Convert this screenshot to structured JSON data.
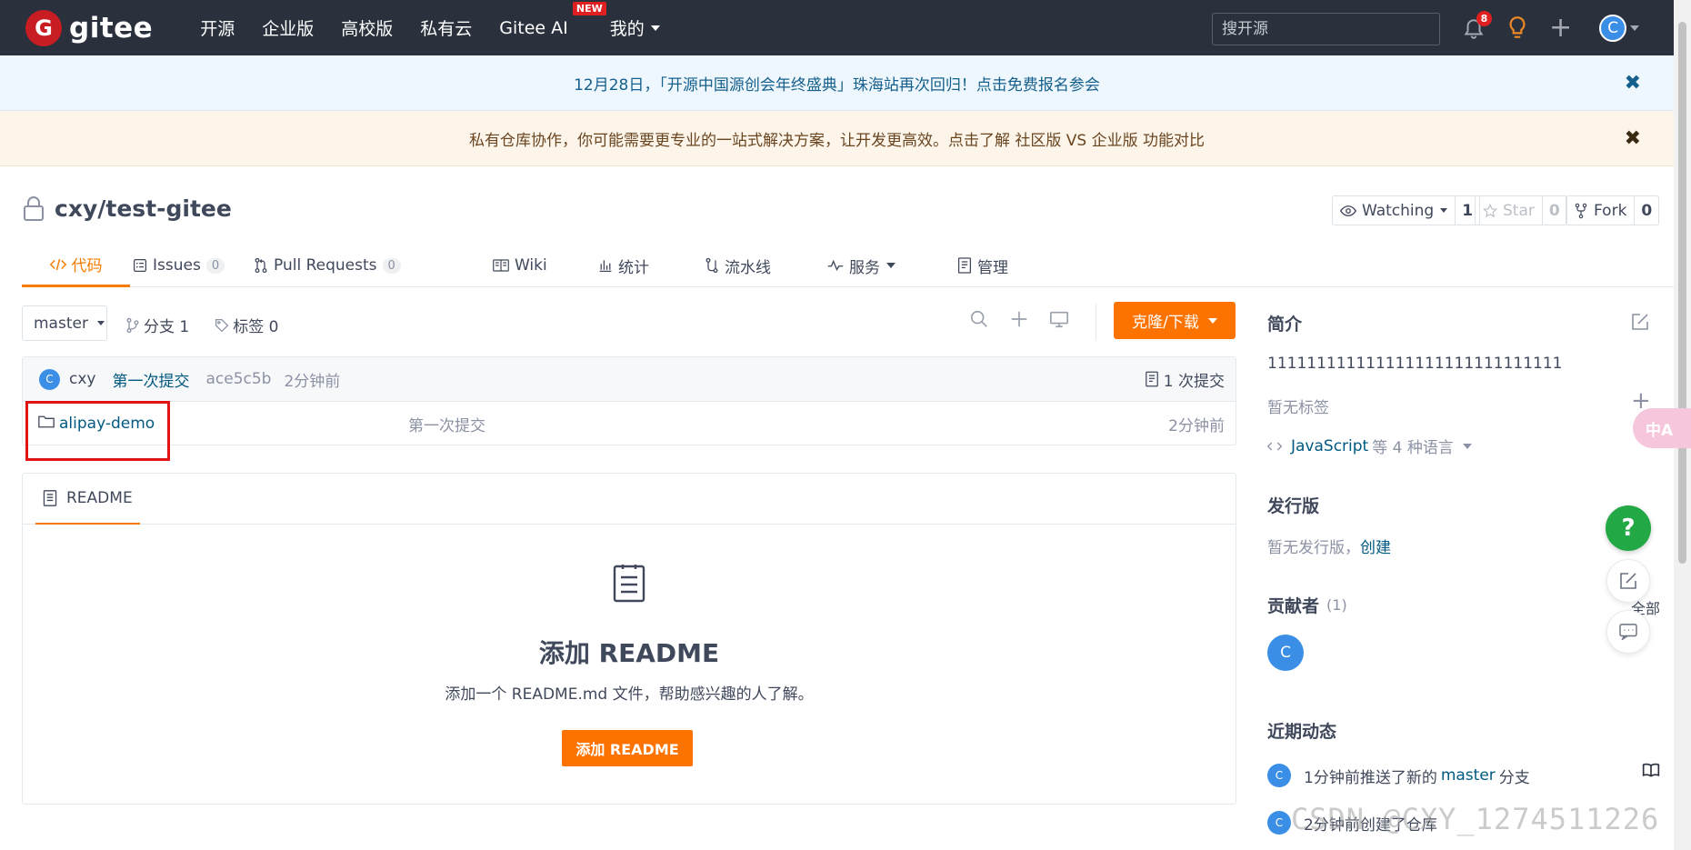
{
  "topnav": {
    "logo_text": "gitee",
    "items": [
      "开源",
      "企业版",
      "高校版",
      "私有云",
      "Gitee AI",
      "我的"
    ],
    "new_badge": "NEW",
    "search_placeholder": "搜开源",
    "notify_count": "8",
    "avatar_letter": "C"
  },
  "banners": {
    "top": "12月28日，「开源中国源创会年终盛典」珠海站再次回归！点击免费报名参会",
    "second": "私有仓库协作，你可能需要更专业的一站式解决方案，让开发更高效。点击了解 社区版 VS 企业版 功能对比",
    "close": "✖"
  },
  "repo": {
    "name": "cxy/test-gitee",
    "watching_label": "Watching",
    "watching_count": "1",
    "star_label": "Star",
    "star_count": "0",
    "fork_label": "Fork",
    "fork_count": "0"
  },
  "tabs": {
    "code": "代码",
    "issues": "Issues",
    "issues_count": "0",
    "pulls": "Pull Requests",
    "pulls_count": "0",
    "wiki": "Wiki",
    "stats": "统计",
    "pipeline": "流水线",
    "services": "服务",
    "manage": "管理"
  },
  "toolbar": {
    "branch": "master",
    "branches": "分支 1",
    "tags": "标签 0",
    "clone": "克隆/下载"
  },
  "commit": {
    "avatar": "C",
    "author": "cxy",
    "message": "第一次提交",
    "sha": "ace5c5b",
    "time": "2分钟前",
    "count": "1 次提交"
  },
  "files": [
    {
      "name": "alipay-demo",
      "message": "第一次提交",
      "time": "2分钟前"
    }
  ],
  "readme": {
    "tab": "README",
    "title": "添加 README",
    "desc": "添加一个 README.md 文件，帮助感兴趣的人了解。",
    "button": "添加 README"
  },
  "sidebar": {
    "intro_title": "简介",
    "intro_text": "111111111111111111111111111111",
    "no_tags": "暂无标签",
    "language_link": "JavaScript",
    "language_rest": "等 4 种语言",
    "release_title": "发行版",
    "no_release": "暂无发行版，",
    "create_link": "创建",
    "contributors_title": "贡献者",
    "contributors_count": "(1)",
    "contributor_avatar": "C",
    "recent_title": "近期动态",
    "activity1_pre": "1分钟前推送了新的",
    "activity1_link": "master",
    "activity1_post": "分支",
    "activity2": "2分钟前创建了仓库",
    "full_label": "全部"
  },
  "floating": {
    "help": "?",
    "translate": "中A"
  },
  "watermark": "CSDN @CXY_1274511226",
  "colors": {
    "accent": "#fe7300",
    "nav_bg": "#2b313c",
    "link": "#005980",
    "brand_red": "#c71d23"
  }
}
